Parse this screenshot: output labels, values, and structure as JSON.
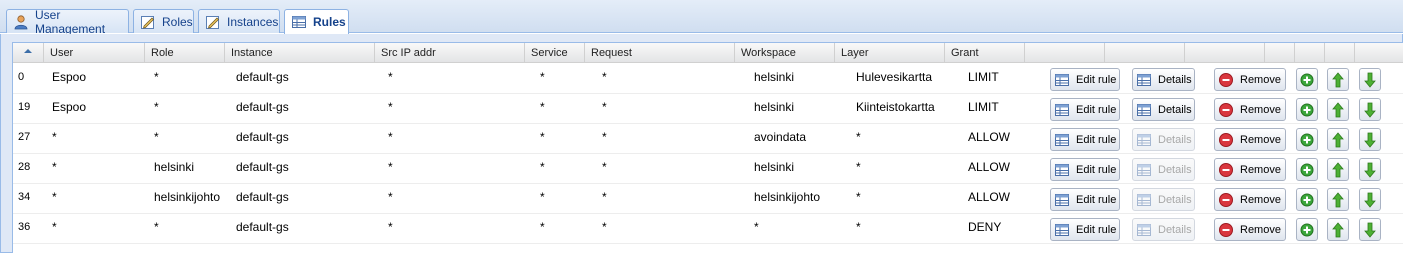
{
  "tabs": [
    {
      "label": "User Management",
      "icon": "user-icon",
      "active": false
    },
    {
      "label": "Roles",
      "icon": "edit-icon",
      "active": false
    },
    {
      "label": "Instances",
      "icon": "edit-icon",
      "active": false
    },
    {
      "label": "Rules",
      "icon": "table-icon",
      "active": true
    }
  ],
  "grid": {
    "columns": [
      "User",
      "Role",
      "Instance",
      "Src IP addr",
      "Service",
      "Request",
      "Workspace",
      "Layer",
      "Grant"
    ],
    "sorted_column": "id",
    "rows": [
      {
        "id": "0",
        "user": "Espoo",
        "role": "*",
        "instance": "default-gs",
        "src_ip": "*",
        "service": "*",
        "request": "*",
        "workspace": "helsinki",
        "layer": "Hulevesikartta",
        "grant": "LIMIT",
        "details_enabled": true
      },
      {
        "id": "19",
        "user": "Espoo",
        "role": "*",
        "instance": "default-gs",
        "src_ip": "*",
        "service": "*",
        "request": "*",
        "workspace": "helsinki",
        "layer": "Kiinteistokartta",
        "grant": "LIMIT",
        "details_enabled": true
      },
      {
        "id": "27",
        "user": "*",
        "role": "*",
        "instance": "default-gs",
        "src_ip": "*",
        "service": "*",
        "request": "*",
        "workspace": "avoindata",
        "layer": "*",
        "grant": "ALLOW",
        "details_enabled": false
      },
      {
        "id": "28",
        "user": "*",
        "role": "helsinki",
        "instance": "default-gs",
        "src_ip": "*",
        "service": "*",
        "request": "*",
        "workspace": "helsinki",
        "layer": "*",
        "grant": "ALLOW",
        "details_enabled": false
      },
      {
        "id": "34",
        "user": "*",
        "role": "helsinkijohto",
        "instance": "default-gs",
        "src_ip": "*",
        "service": "*",
        "request": "*",
        "workspace": "helsinkijohto",
        "layer": "*",
        "grant": "ALLOW",
        "details_enabled": false
      },
      {
        "id": "36",
        "user": "*",
        "role": "*",
        "instance": "default-gs",
        "src_ip": "*",
        "service": "*",
        "request": "*",
        "workspace": "*",
        "layer": "*",
        "grant": "DENY",
        "details_enabled": false
      }
    ],
    "actions": {
      "edit_label": "Edit rule",
      "details_label": "Details",
      "remove_label": "Remove"
    }
  },
  "colors": {
    "tab_text": "#15428b",
    "border": "#99bbe8",
    "remove_red": "#d9363e",
    "add_green": "#3aa63a",
    "arrow_green": "#3f9b2f"
  }
}
